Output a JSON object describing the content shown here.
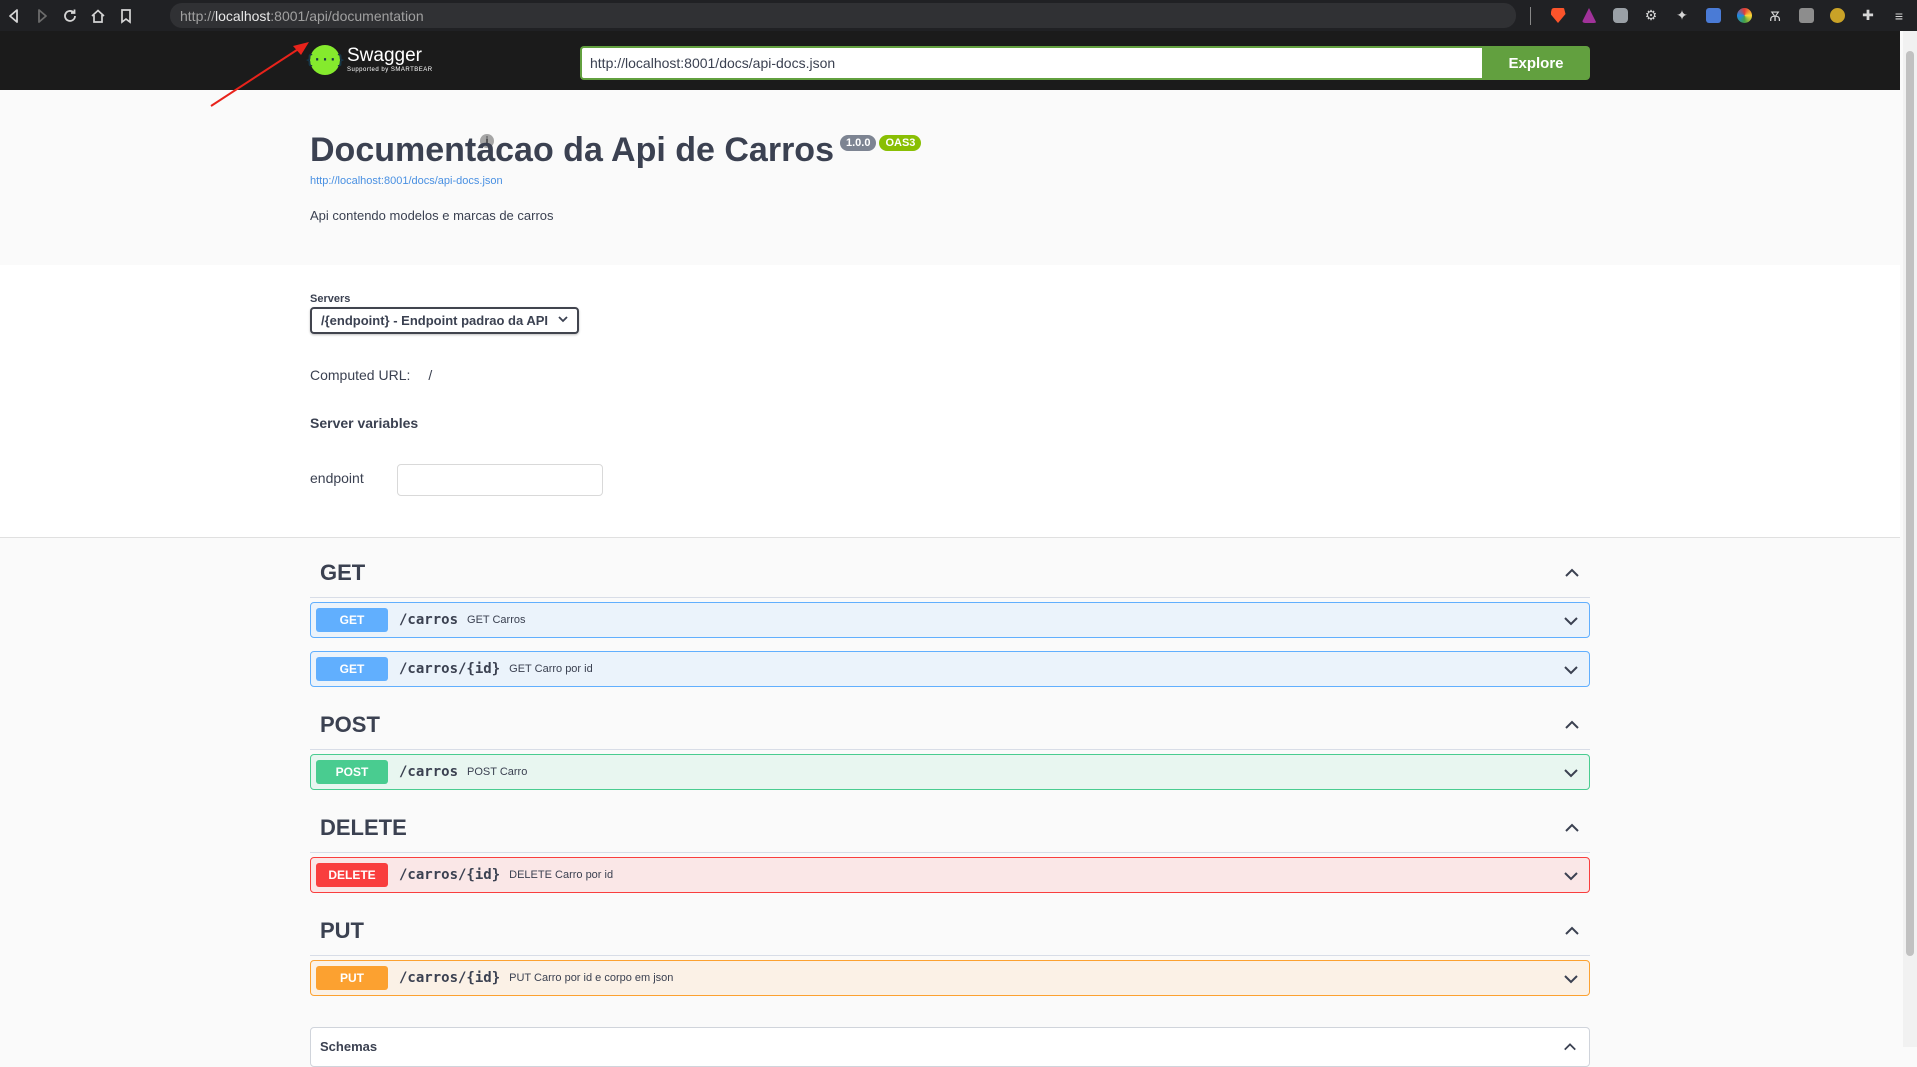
{
  "browser": {
    "url_scheme": "http://",
    "url_host": "localhost",
    "url_rest": ":8001/api/documentation",
    "info_glyph": "i",
    "icons": [
      "back-icon",
      "forward-icon",
      "reload-icon",
      "home-icon",
      "bookmark-icon",
      "brave-shield-icon",
      "brave-rewards-icon",
      "camera-icon",
      "gear-icon",
      "extension-icon",
      "translate-icon",
      "color-picker-icon",
      "text-icon",
      "reader-icon",
      "theme-icon",
      "puzzle-icon",
      "menu-icon"
    ]
  },
  "topbar": {
    "logo_glyph": "{···}",
    "logo_name": "Swagger",
    "logo_tagline": "Supported by SMARTBEAR",
    "explore_url": "http://localhost:8001/docs/api-docs.json",
    "explore_label": "Explore",
    "accent": "#62a03f"
  },
  "info": {
    "title": "Documentacao da Api de Carros",
    "version": "1.0.0",
    "oas": "OAS3",
    "link": "http://localhost:8001/docs/api-docs.json",
    "description": "Api contendo modelos e marcas de carros"
  },
  "servers": {
    "label": "Servers",
    "selected": "/{endpoint} - Endpoint padrao da API",
    "computed_label": "Computed URL:",
    "computed_value": "/",
    "variables_title": "Server variables",
    "variable_name": "endpoint",
    "variable_value": ""
  },
  "tags": [
    {
      "name": "GET",
      "operations": [
        {
          "method": "GET",
          "path": "/carros",
          "summary": "GET Carros"
        },
        {
          "method": "GET",
          "path": "/carros/{id}",
          "summary": "GET Carro por id"
        }
      ]
    },
    {
      "name": "POST",
      "operations": [
        {
          "method": "POST",
          "path": "/carros",
          "summary": "POST Carro"
        }
      ]
    },
    {
      "name": "DELETE",
      "operations": [
        {
          "method": "DELETE",
          "path": "/carros/{id}",
          "summary": "DELETE Carro por id"
        }
      ]
    },
    {
      "name": "PUT",
      "operations": [
        {
          "method": "PUT",
          "path": "/carros/{id}",
          "summary": "PUT Carro por id e corpo em json"
        }
      ]
    }
  ],
  "schemas": {
    "label": "Schemas"
  },
  "colors": {
    "get": "#61affe",
    "post": "#49cc90",
    "delete": "#f93e3e",
    "put": "#fca130",
    "annotation_arrow": "#e8231b"
  }
}
